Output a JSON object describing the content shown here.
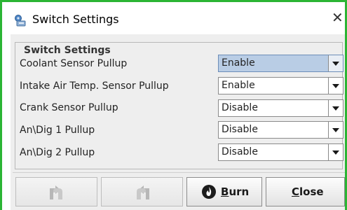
{
  "window": {
    "title": "Switch Settings",
    "close_glyph": "✕",
    "icon": "settings-app-icon",
    "frame_color": "#2bb534"
  },
  "group": {
    "title": "Switch Settings"
  },
  "settings": [
    {
      "label": "Coolant Sensor Pullup",
      "value": "Enable",
      "active": true
    },
    {
      "label": "Intake Air Temp. Sensor Pullup",
      "value": "Enable",
      "active": false
    },
    {
      "label": "Crank Sensor Pullup",
      "value": "Disable",
      "active": false
    },
    {
      "label": "An\\Dig 1 Pullup",
      "value": "Disable",
      "active": false
    },
    {
      "label": "An\\Dig 2  Pullup",
      "value": "Disable",
      "active": false
    }
  ],
  "buttons": {
    "undo": {
      "icon": "undo-arrow-icon",
      "enabled": false
    },
    "redo": {
      "icon": "redo-arrow-icon",
      "enabled": false
    },
    "burn": {
      "label_u": "B",
      "label_rest": "urn",
      "icon": "flame-icon"
    },
    "close": {
      "label_u": "C",
      "label_rest": "lose"
    }
  },
  "colors": {
    "selected_combo": "#b9cde5",
    "panel_bg": "#eeeeee"
  }
}
